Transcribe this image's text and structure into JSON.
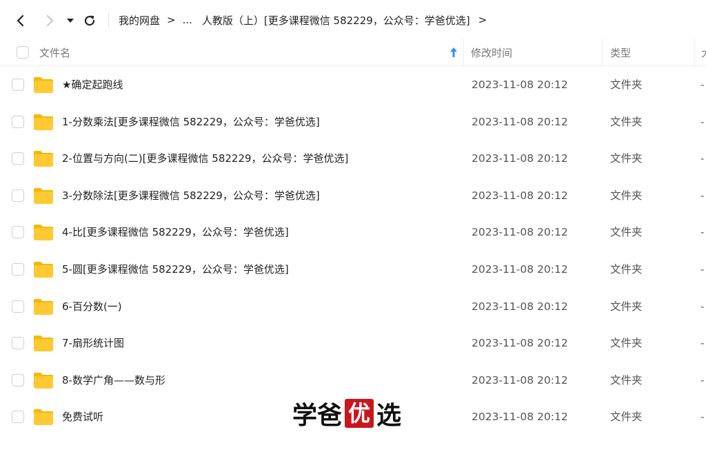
{
  "toolbar": {
    "back_icon": "chevron-left-icon",
    "forward_icon": "chevron-right-icon",
    "history_icon": "caret-down-icon",
    "refresh_icon": "refresh-icon"
  },
  "breadcrumb": {
    "root": "我的网盘",
    "ellipsis": "...",
    "current": "人教版（上）[更多课程微信 582229，公众号：学爸优选]"
  },
  "header": {
    "name": "文件名",
    "modified": "修改时间",
    "type": "类型",
    "size": "大"
  },
  "files": [
    {
      "name": "★确定起跑线",
      "modified": "2023-11-08 20:12",
      "type": "文件夹",
      "size": "-"
    },
    {
      "name": "1-分数乘法[更多课程微信 582229，公众号：学爸优选]",
      "modified": "2023-11-08 20:12",
      "type": "文件夹",
      "size": "-"
    },
    {
      "name": "2-位置与方向(二)[更多课程微信 582229，公众号：学爸优选]",
      "modified": "2023-11-08 20:12",
      "type": "文件夹",
      "size": "-"
    },
    {
      "name": "3-分数除法[更多课程微信 582229，公众号：学爸优选]",
      "modified": "2023-11-08 20:12",
      "type": "文件夹",
      "size": "-"
    },
    {
      "name": "4-比[更多课程微信 582229，公众号：学爸优选]",
      "modified": "2023-11-08 20:12",
      "type": "文件夹",
      "size": "-"
    },
    {
      "name": "5-圆[更多课程微信 582229，公众号：学爸优选]",
      "modified": "2023-11-08 20:12",
      "type": "文件夹",
      "size": "-"
    },
    {
      "name": "6-百分数(一)",
      "modified": "2023-11-08 20:12",
      "type": "文件夹",
      "size": "-"
    },
    {
      "name": "7-扇形统计图",
      "modified": "2023-11-08 20:12",
      "type": "文件夹",
      "size": "-"
    },
    {
      "name": "8-数学广角——数与形",
      "modified": "2023-11-08 20:12",
      "type": "文件夹",
      "size": "-"
    },
    {
      "name": "免费试听",
      "modified": "2023-11-08 20:12",
      "type": "文件夹",
      "size": "-"
    }
  ],
  "watermark": {
    "part1": "学爸",
    "seal": "优",
    "part2": "选"
  },
  "colors": {
    "folder": "#FFC933",
    "folder_back": "#F5B800",
    "sort_arrow": "#2D8CFF",
    "seal": "#C8161D"
  }
}
